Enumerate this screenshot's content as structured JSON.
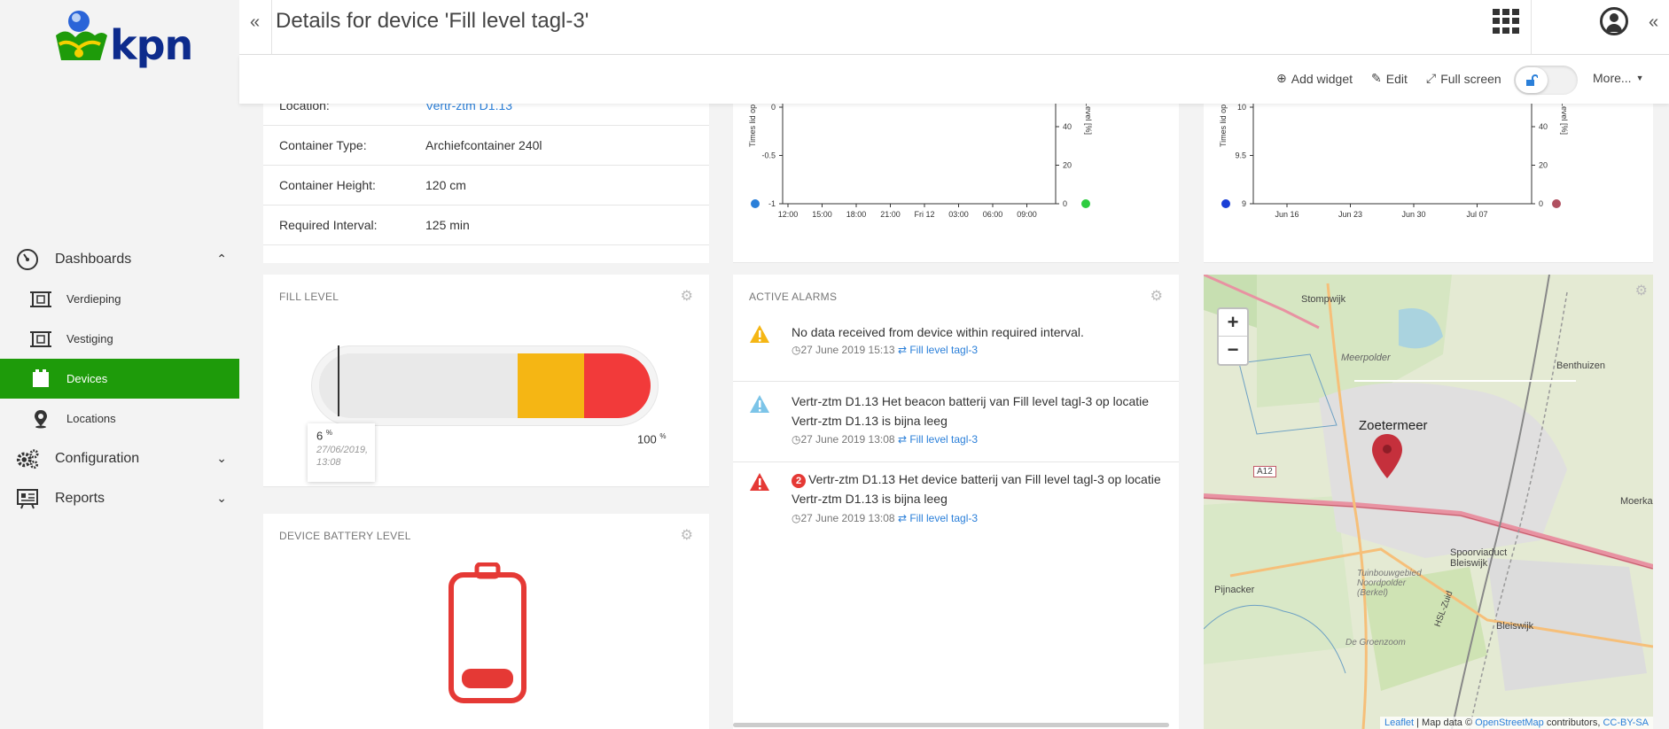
{
  "brand": {
    "name": "kpn",
    "color": "#0d2b8c",
    "accent": "#1e9b0a"
  },
  "sidebar": {
    "items": [
      {
        "label": "Dashboards",
        "icon": "dashboard-icon",
        "expanded": true
      },
      {
        "label": "Verdieping",
        "icon": "floorplan-icon",
        "sub": true
      },
      {
        "label": "Vestiging",
        "icon": "floorplan-icon",
        "sub": true
      },
      {
        "label": "Devices",
        "icon": "devices-icon",
        "sub": true,
        "active": true
      },
      {
        "label": "Locations",
        "icon": "location-pin-icon",
        "sub": true
      },
      {
        "label": "Configuration",
        "icon": "gears-icon",
        "expanded": false
      },
      {
        "label": "Reports",
        "icon": "report-icon",
        "expanded": false
      }
    ]
  },
  "header": {
    "title": "Details for device 'Fill level tagl-3'",
    "collapse_left": "«",
    "collapse_right": "«"
  },
  "toolbar": {
    "add_widget": "Add widget",
    "edit": "Edit",
    "full_screen": "Full screen",
    "more": "More..."
  },
  "info": {
    "rows": [
      {
        "key": "Location:",
        "value": "Vertr-ztm D1.13"
      },
      {
        "key": "Container Type:",
        "value": "Archiefcontainer 240l"
      },
      {
        "key": "Container Height:",
        "value": "120 cm"
      },
      {
        "key": "Required Interval:",
        "value": "125 min"
      }
    ]
  },
  "chart_data": [
    {
      "type": "line",
      "ylabel_left": "Times lid op",
      "ylabel_right": "Level [%]",
      "yticks_left": [
        "0",
        "-0.5",
        "-1"
      ],
      "yticks_right": [
        "40",
        "20",
        "0"
      ],
      "xticks": [
        "12:00",
        "15:00",
        "18:00",
        "21:00",
        "Fri 12",
        "03:00",
        "06:00",
        "09:00"
      ],
      "ylim_left": [
        -1,
        0
      ],
      "series": [
        {
          "color": "#2a7fd9",
          "values": []
        },
        {
          "color": "#2ecc40",
          "values": []
        }
      ]
    },
    {
      "type": "line",
      "ylabel_left": "Times lid op",
      "ylabel_right": "Level [%]",
      "yticks_left": [
        "10",
        "9.5",
        "9"
      ],
      "yticks_right": [
        "40",
        "20",
        "0"
      ],
      "xticks": [
        "Jun 16",
        "Jun 23",
        "Jun 30",
        "Jul 07"
      ],
      "ylim_left": [
        9,
        10
      ],
      "series": [
        {
          "color": "#1a3fd6",
          "values": []
        },
        {
          "color": "#b05060",
          "values": []
        }
      ]
    }
  ],
  "fill_level": {
    "title": "FILL LEVEL",
    "value": 6,
    "value_label": "6",
    "unit": "%",
    "date": "27/06/2019, 13:08",
    "max_label": "100",
    "segments": [
      {
        "from": 0,
        "to": 60,
        "color": "#e9e9e9"
      },
      {
        "from": 60,
        "to": 80,
        "color": "#f5b614"
      },
      {
        "from": 80,
        "to": 100,
        "color": "#f23a3a"
      }
    ]
  },
  "alarms": {
    "title": "ACTIVE ALARMS",
    "items": [
      {
        "severity": "warning",
        "color": "#f5b614",
        "count": "",
        "message": "No data received from device within required interval.",
        "time": "27 June 2019 15:13",
        "device": "Fill level tagl-3"
      },
      {
        "severity": "info",
        "color": "#7cc4e8",
        "count": "",
        "message": "Vertr-ztm D1.13 Het beacon batterij van Fill level tagl-3 op locatie Vertr-ztm D1.13 is bijna leeg",
        "time": "27 June 2019 13:08",
        "device": "Fill level tagl-3"
      },
      {
        "severity": "critical",
        "color": "#e53935",
        "count": "2",
        "message": "Vertr-ztm D1.13 Het device batterij van Fill level tagl-3 op locatie Vertr-ztm D1.13 is bijna leeg",
        "time": "27 June 2019 13:08",
        "device": "Fill level tagl-3"
      }
    ]
  },
  "map": {
    "zoom_in": "+",
    "zoom_out": "−",
    "labels": {
      "stompwijk": "Stompwijk",
      "meerpolder": "Meerpolder",
      "benthuizen": "Benthuizen",
      "zoetermeer": "Zoetermeer",
      "a12": "A12",
      "moerka": "Moerka",
      "spoorviaduct": "Spoorviaduct Bleiswijk",
      "tuinbouw": "Tuinbouwgebied Noordpolder (Berkel)",
      "pijnacker": "Pijnacker",
      "bleiswijk": "Bleiswijk",
      "groenzoom": "De Groenzoom",
      "hsl": "HSL-Zuid"
    },
    "attribution": {
      "leaflet": "Leaflet",
      "mid": " | Map data © ",
      "osm": "OpenStreetMap",
      "contrib": " contributors, ",
      "license": "CC-BY-SA"
    }
  },
  "battery": {
    "title": "DEVICE BATTERY LEVEL",
    "level_color": "#e53935"
  }
}
